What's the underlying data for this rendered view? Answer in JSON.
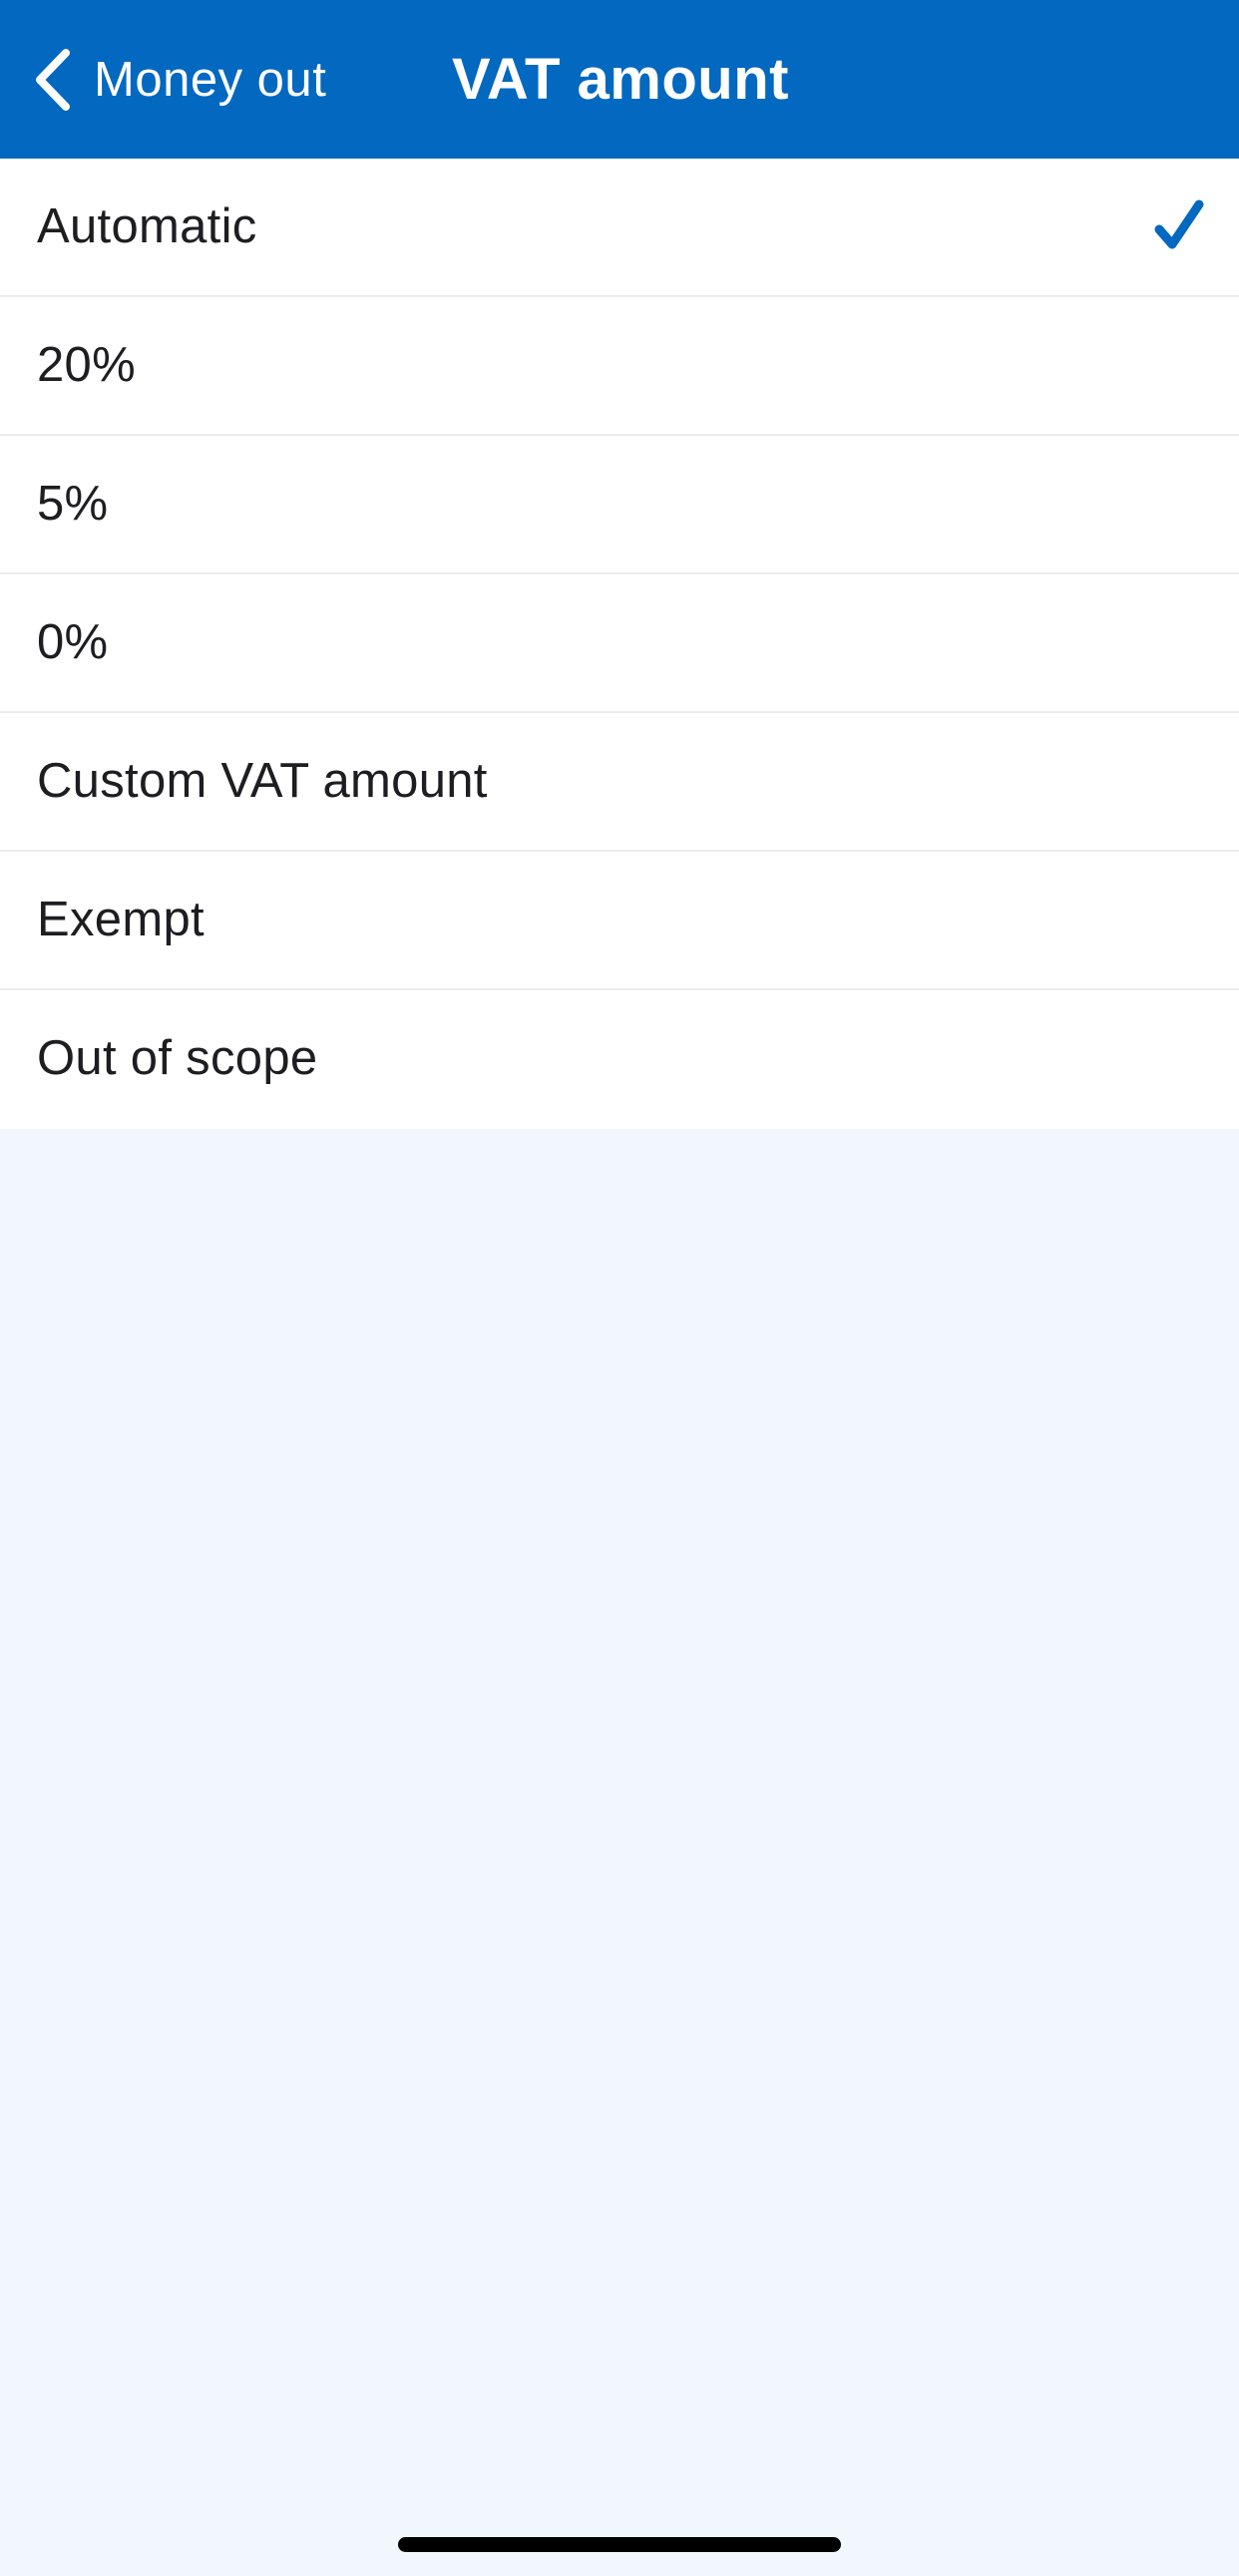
{
  "nav": {
    "back_label": "Money out",
    "title": "VAT amount",
    "background_color": "#0268c0"
  },
  "options": [
    {
      "label": "Automatic",
      "selected": true
    },
    {
      "label": "20%",
      "selected": false
    },
    {
      "label": "5%",
      "selected": false
    },
    {
      "label": "0%",
      "selected": false
    },
    {
      "label": "Custom VAT amount",
      "selected": false
    },
    {
      "label": "Exempt",
      "selected": false
    },
    {
      "label": "Out of scope",
      "selected": false
    }
  ],
  "icons": {
    "back": "chevron-left-icon",
    "selected": "checkmark-icon"
  },
  "colors": {
    "accent": "#0268c0",
    "page_background": "#f2f6fd",
    "row_background": "#ffffff",
    "text": "#1e1e22"
  }
}
